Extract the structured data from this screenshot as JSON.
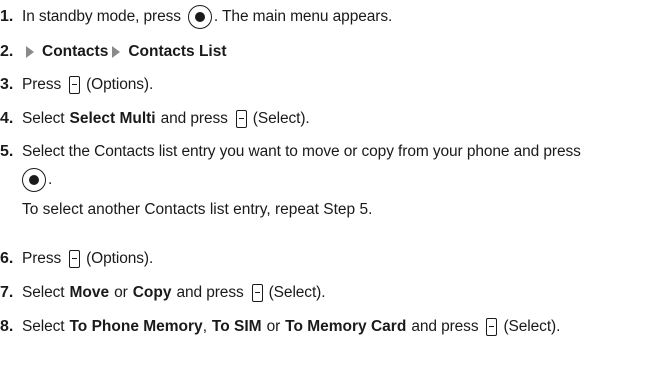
{
  "steps": [
    {
      "num": "1.",
      "a": "In standby mode, press",
      "b": ". The main menu appears."
    },
    {
      "num": "2.",
      "a": "Contacts",
      "b": "Contacts List"
    },
    {
      "num": "3.",
      "a": "Press",
      "b": "(Options)."
    },
    {
      "num": "4.",
      "a": "Select",
      "bold": "Select Multi",
      "b": "and press",
      "c": "(Select)."
    },
    {
      "num": "5.",
      "a": "Select the Contacts list entry you want to move or copy from your phone and press",
      "b": "."
    },
    {
      "num": "6.",
      "a": "Press",
      "b": "(Options)."
    },
    {
      "num": "7.",
      "a": "Select",
      "bold1": "Move",
      "or": "or",
      "bold2": "Copy",
      "b": "and press",
      "c": "(Select)."
    },
    {
      "num": "8.",
      "a": "Select",
      "bold1": "To Phone Memory",
      "comma": ",",
      "bold2": "To SIM",
      "or": "or",
      "bold3": "To Memory Card",
      "b": "and press",
      "c": "(Select)."
    }
  ],
  "note": "To select another Contacts list entry, repeat Step 5."
}
